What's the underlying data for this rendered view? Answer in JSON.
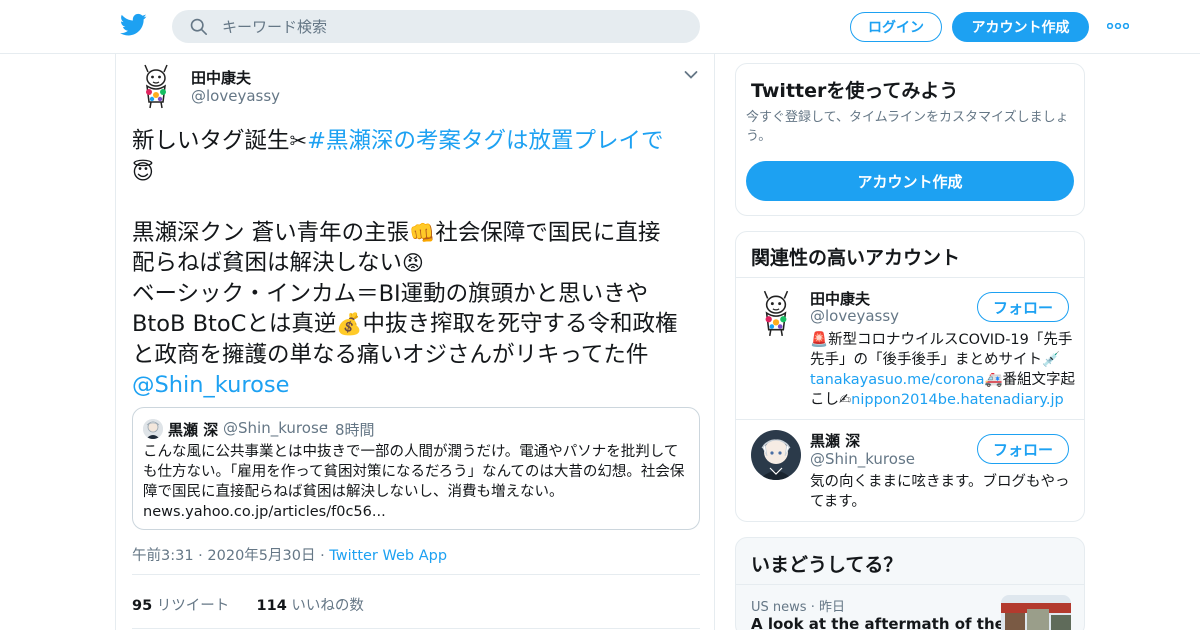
{
  "header": {
    "search_placeholder": "キーワード検索",
    "login_label": "ログイン",
    "signup_label": "アカウント作成",
    "brand_color": "#1da1f2"
  },
  "tweet": {
    "author_name": "田中康夫",
    "author_handle": "@loveyassy",
    "text_intro": "新しいタグ誕生",
    "hashtag": "#黒瀬深の考案タグは放置プレイで",
    "body_line1": "黒瀬深クン 蒼い青年の主張",
    "body_line2": "社会保障で国民に直接",
    "body_line3": "配らねば貧困は解決しない",
    "body_line4": "ベーシック・インカム＝BI運動の旗頭かと思いきや",
    "body_line5a": "BtoB BtoCとは真逆",
    "body_line5b": "中抜き搾取を死守する令和政権",
    "body_line6": "と政商を擁護の単なる痛いオジさんがリキってた件",
    "mention": "@Shin_kurose",
    "time": "午前3:31",
    "date": "2020年5月30日",
    "app": "Twitter Web App",
    "retweets_count": "95",
    "retweets_label": "リツイート",
    "likes_count": "114",
    "likes_label": "いいねの数"
  },
  "quote": {
    "name": "黒瀬 深",
    "handle": "@Shin_kurose",
    "time": "8時間",
    "text": "こんな風に公共事業とは中抜きで一部の人間が潤うだけ。電通やパソナを批判しても仕方ない。「雇用を作って貧困対策になるだろう」なんてのは大昔の幻想。社会保障で国民に直接配らねば貧困は解決しないし、消費も増えない。news.yahoo.co.jp/articles/f0c56..."
  },
  "sidebar": {
    "promo": {
      "title": "Twitterを使ってみよう",
      "subtitle": "今すぐ登録して、タイムラインをカスタマイズしましょう。",
      "button": "アカウント作成"
    },
    "related": {
      "title": "関連性の高いアカウント",
      "follow_label": "フォロー",
      "accounts": [
        {
          "name": "田中康夫",
          "handle": "@loveyassy",
          "bio_1": "新型コロナウイルスCOVID-19「先手先手」の「後手後手」まとめサイト",
          "bio_link1": "tanakayasuo.me/corona",
          "bio_2": "番組文字起こし",
          "bio_link2": "nippon2014be.hatenadiary.jp"
        },
        {
          "name": "黒瀬 深",
          "handle": "@Shin_kurose",
          "bio": "気の向くままに呟きます。ブログもやってます。"
        }
      ]
    },
    "trends": {
      "title": "いまどうしてる？",
      "item_source": "US news",
      "item_time": "昨日",
      "item_title": "A look at the aftermath of the"
    }
  }
}
